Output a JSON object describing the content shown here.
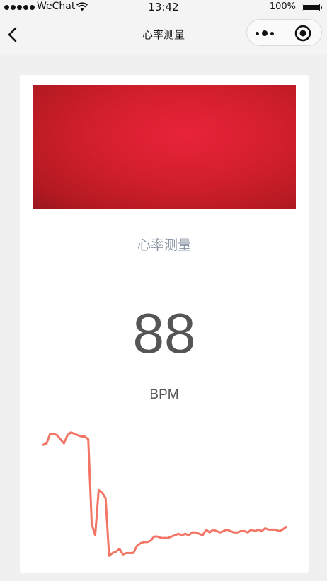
{
  "status_bar": {
    "carrier": "WeChat",
    "time": "13:42",
    "battery": "100%"
  },
  "nav": {
    "title": "心率测量"
  },
  "measure": {
    "title": "心率测量",
    "bpm": "88",
    "unit": "BPM"
  },
  "colors": {
    "waveform": "#f37565",
    "camera": "#d21f2c"
  },
  "waveform": {
    "values": [
      0.14,
      0.13,
      0.06,
      0.06,
      0.07,
      0.1,
      0.13,
      0.07,
      0.05,
      0.06,
      0.07,
      0.08,
      0.08,
      0.1,
      0.72,
      0.8,
      0.47,
      0.49,
      0.53,
      0.95,
      0.93,
      0.92,
      0.9,
      0.94,
      0.93,
      0.93,
      0.93,
      0.88,
      0.86,
      0.85,
      0.85,
      0.84,
      0.81,
      0.81,
      0.82,
      0.82,
      0.82,
      0.81,
      0.8,
      0.79,
      0.8,
      0.79,
      0.8,
      0.78,
      0.78,
      0.79,
      0.8,
      0.76,
      0.78,
      0.76,
      0.77,
      0.78,
      0.77,
      0.76,
      0.77,
      0.78,
      0.78,
      0.77,
      0.77,
      0.78,
      0.76,
      0.77,
      0.76,
      0.77,
      0.75,
      0.76,
      0.76,
      0.76,
      0.77,
      0.76,
      0.74
    ],
    "min_label": "",
    "max_label": ""
  }
}
